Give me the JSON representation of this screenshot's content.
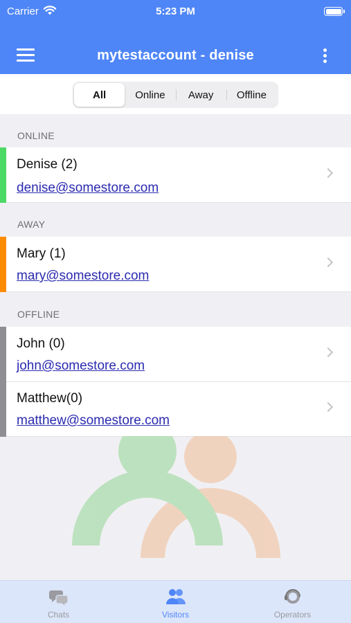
{
  "status": {
    "carrier": "Carrier",
    "time": "5:23 PM"
  },
  "header": {
    "title": "mytestaccount - denise"
  },
  "filter": {
    "options": [
      "All",
      "Online",
      "Away",
      "Offline"
    ],
    "selected": "All"
  },
  "sections": [
    {
      "label": "ONLINE",
      "color": "#4cd964",
      "items": [
        {
          "name": "Denise (2)",
          "email": "denise@somestore.com"
        }
      ]
    },
    {
      "label": "AWAY",
      "color": "#ff8c00",
      "items": [
        {
          "name": "Mary (1)",
          "email": "mary@somestore.com"
        }
      ]
    },
    {
      "label": "OFFLINE",
      "color": "#8e8e93",
      "items": [
        {
          "name": "John (0)",
          "email": "john@somestore.com"
        },
        {
          "name": "Matthew(0)",
          "email": "matthew@somestore.com"
        }
      ]
    }
  ],
  "tabs": [
    {
      "label": "Chats",
      "icon": "chat-bubbles-icon",
      "active": false
    },
    {
      "label": "Visitors",
      "icon": "people-icon",
      "active": true
    },
    {
      "label": "Operators",
      "icon": "headset-operator-icon",
      "active": false
    }
  ],
  "colors": {
    "accent": "#4f86f7",
    "online": "#4cd964",
    "away": "#ff8c00",
    "offline": "#8e8e93",
    "link": "#2a2ab0"
  }
}
